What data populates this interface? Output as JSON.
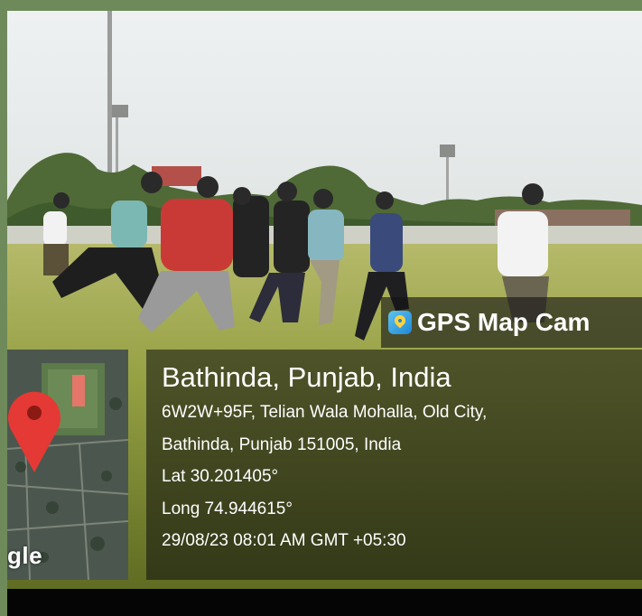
{
  "app_badge": {
    "name": "GPS Map Cam",
    "icon": "gps-map-cam-icon"
  },
  "map": {
    "watermark": "gle",
    "pin_color": "#e53935"
  },
  "location": {
    "title": "Bathinda, Punjab, India",
    "address_line1": "6W2W+95F, Telian Wala Mohalla, Old City,",
    "address_line2": "Bathinda, Punjab 151005, India",
    "lat": "Lat 30.201405°",
    "long": "Long 74.944615°",
    "datetime": "29/08/23 08:01 AM GMT +05:30"
  },
  "colors": {
    "frame": "#6f8a5a",
    "sky": "#e4e8ea",
    "grass": "#8a9a3c"
  }
}
